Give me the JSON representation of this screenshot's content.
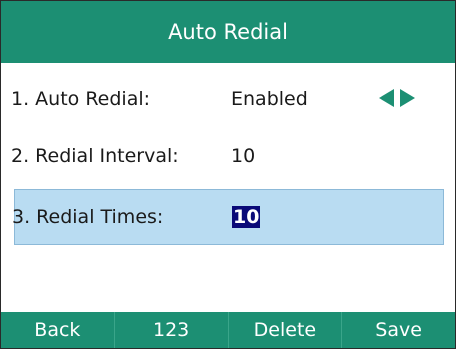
{
  "title": "Auto Redial",
  "rows": [
    {
      "label": "1. Auto Redial:",
      "value": "Enabled"
    },
    {
      "label": "2. Redial Interval:",
      "value": "10"
    },
    {
      "label": "3. Redial Times:",
      "value": "10"
    }
  ],
  "softkeys": [
    "Back",
    "123",
    "Delete",
    "Save"
  ],
  "colors": {
    "accent": "#1c8f73",
    "selection": "#b9dcf2",
    "text_highlight": "#0a0a78"
  },
  "icons": {
    "left": "arrow-left-icon",
    "right": "arrow-right-icon"
  }
}
